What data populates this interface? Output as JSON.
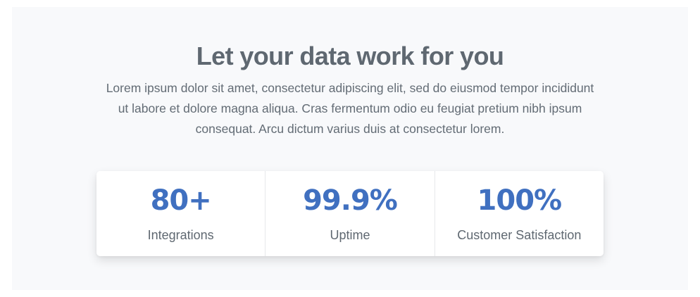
{
  "hero": {
    "title": "Let your data work for you",
    "description": "Lorem ipsum dolor sit amet, consectetur adipiscing elit, sed do eiusmod tempor incididunt ut labore et dolore magna aliqua. Cras fermentum odio eu feugiat pretium nibh ipsum consequat. Arcu dictum varius duis at consectetur lorem."
  },
  "stats": [
    {
      "value": "80+",
      "label": "Integrations"
    },
    {
      "value": "99.9%",
      "label": "Uptime"
    },
    {
      "value": "100%",
      "label": "Customer Satisfaction"
    }
  ],
  "colors": {
    "accent": "#4070c0",
    "heading": "#5f6871",
    "section_background": "#f8f9fb"
  }
}
